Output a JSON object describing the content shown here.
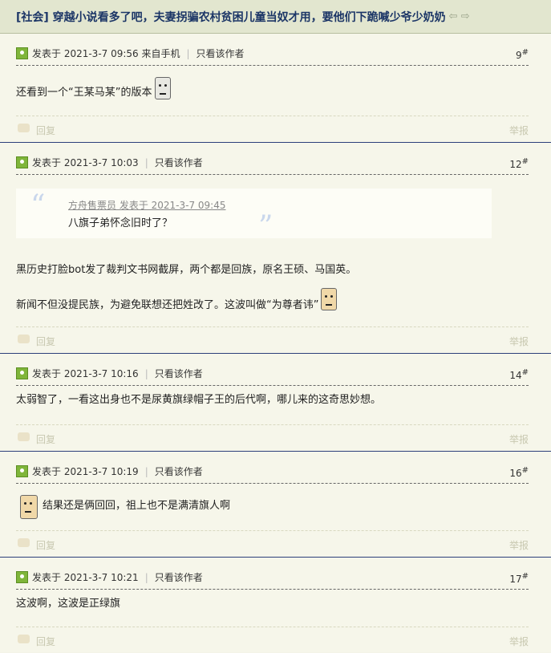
{
  "thread": {
    "title": "[社会] 穿越小说看多了吧，夫妻拐骗农村贫困儿童当奴才用，要他们下跪喊少爷少奶奶",
    "prev_icon": "⇦",
    "next_icon": "⇨"
  },
  "labels": {
    "only_author": "只看该作者",
    "reply": "回复",
    "report": "举报"
  },
  "posts": [
    {
      "meta": "发表于 2021-3-7 09:56 来自手机",
      "floor": "9",
      "lines": [
        "还看到一个“王某马某”的版本"
      ]
    },
    {
      "meta": "发表于 2021-3-7 10:03",
      "floor": "12",
      "quote": {
        "author": "方舟售票员 发表于 2021-3-7 09:45",
        "text": "八旗子弟怀念旧时了？"
      },
      "lines": [
        "黑历史打脸bot发了裁判文书网截屏，两个都是回族，原名王硕、马国英。",
        "新闻不但没提民族，为避免联想还把姓改了。这波叫做“为尊者讳”"
      ]
    },
    {
      "meta": "发表于 2021-3-7 10:16",
      "floor": "14",
      "lines": [
        "太弱智了，一看这出身也不是尿黄旗绿帽子王的后代啊，哪儿来的这奇思妙想。"
      ]
    },
    {
      "meta": "发表于 2021-3-7 10:19",
      "floor": "16",
      "lines": [
        "结果还是俩回回，祖上也不是满清旗人啊"
      ]
    },
    {
      "meta": "发表于 2021-3-7 10:21",
      "floor": "17",
      "lines": [
        "这波啊，这波是正绿旗"
      ]
    }
  ],
  "icons": {
    "avatar": "user-avatar-icon",
    "reply": "reply-icon",
    "emoji": "emoticon-icon"
  }
}
